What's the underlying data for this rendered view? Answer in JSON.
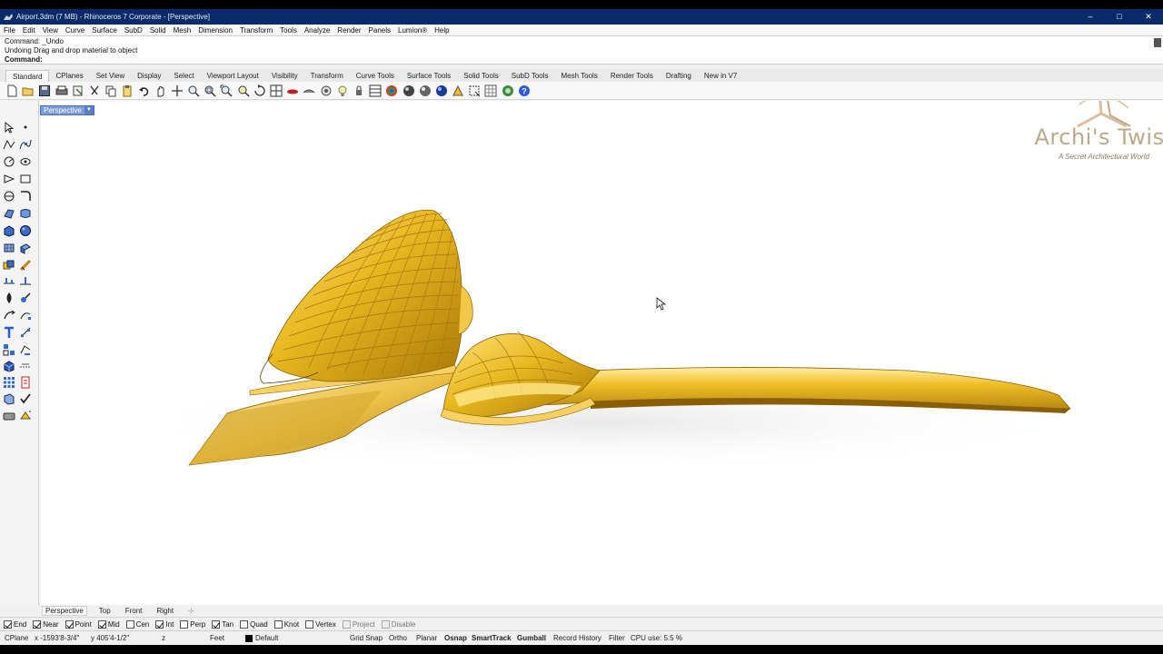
{
  "window": {
    "title": "Airport.3dm (7 MB) - Rhinoceros 7 Corporate - [Perspective]",
    "minimize": "–",
    "maximize": "□",
    "close": "✕"
  },
  "menu": [
    "File",
    "Edit",
    "View",
    "Curve",
    "Surface",
    "SubD",
    "Solid",
    "Mesh",
    "Dimension",
    "Transform",
    "Tools",
    "Analyze",
    "Render",
    "Panels",
    "Lumion®",
    "Help"
  ],
  "command": {
    "history_1": "Command: _Undo",
    "history_2": "Undoing Drag and drop material to object",
    "prompt": "Command:"
  },
  "toolbar_tabs": [
    "Standard",
    "CPlanes",
    "Set View",
    "Display",
    "Select",
    "Viewport Layout",
    "Visibility",
    "Transform",
    "Curve Tools",
    "Surface Tools",
    "Solid Tools",
    "SubD Tools",
    "Mesh Tools",
    "Render Tools",
    "Drafting",
    "New in V7"
  ],
  "active_tab": "Standard",
  "toolbar_icons": [
    "new-file-icon",
    "open-icon",
    "save-icon",
    "print-icon",
    "import-icon",
    "cut-icon",
    "copy-icon",
    "paste-icon",
    "undo-icon",
    "pan-icon",
    "move-icon",
    "zoom-icon",
    "zoom-window-icon",
    "zoom-extents-icon",
    "zoom-selected-icon",
    "rotate-view-icon",
    "four-views-icon",
    "hide-icon",
    "show-icon",
    "lock-icon",
    "light-icon",
    "properties-icon",
    "layer-icon",
    "render-sphere-icon",
    "material-icon",
    "environment-icon",
    "render-icon",
    "lumion-icon",
    "snap-icon",
    "grid-icon",
    "sun-icon",
    "help-icon"
  ],
  "viewport": {
    "label": "Perspective",
    "accent": "#7a9bd8"
  },
  "watermark": {
    "title": "Archi's Twist",
    "subtitle": "A Secret Architectural World"
  },
  "view_tabs": [
    "Perspective",
    "Top",
    "Front",
    "Right"
  ],
  "view_tab_add": "⊹",
  "osnaps": [
    {
      "label": "End",
      "checked": true
    },
    {
      "label": "Near",
      "checked": true
    },
    {
      "label": "Point",
      "checked": true
    },
    {
      "label": "Mid",
      "checked": true
    },
    {
      "label": "Cen",
      "checked": false
    },
    {
      "label": "Int",
      "checked": true
    },
    {
      "label": "Perp",
      "checked": false
    },
    {
      "label": "Tan",
      "checked": true
    },
    {
      "label": "Quad",
      "checked": false
    },
    {
      "label": "Knot",
      "checked": false
    },
    {
      "label": "Vertex",
      "checked": false
    },
    {
      "label": "Project",
      "checked": false,
      "disabled": true
    },
    {
      "label": "Disable",
      "checked": false,
      "disabled": true
    }
  ],
  "status": {
    "cplane": "CPlane",
    "x": "x -1593'8-3/4\"",
    "y": "y 405'4-1/2\"",
    "z": "z",
    "units": "Feet",
    "layer": "Default",
    "grid_snap": "Grid Snap",
    "ortho": "Ortho",
    "planar": "Planar",
    "osnap": "Osnap",
    "smarttrack": "SmartTrack",
    "gumball": "Gumball",
    "record_history": "Record History",
    "filter": "Filter",
    "cpu": "CPU use: 5.5 %"
  },
  "colors": {
    "gold_light": "#ffe27a",
    "gold_mid": "#e8b820",
    "gold_dark": "#a87808",
    "titlebar": "#0a2a6a"
  }
}
